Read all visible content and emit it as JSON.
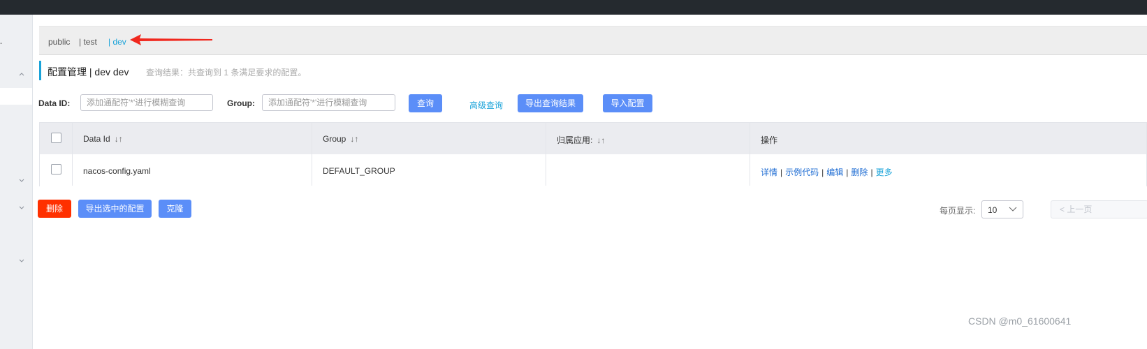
{
  "namespaces": [
    {
      "label": "public"
    },
    {
      "label": "| test"
    },
    {
      "label": "| dev"
    }
  ],
  "colors": {
    "accent": "#1aa3d9",
    "primary_button": "#5b8ef8",
    "danger_button": "#ff3000",
    "topbar": "#252a2f"
  },
  "page": {
    "title": "配置管理 | dev dev",
    "query_result": "查询结果：共查询到 1 条满足要求的配置。"
  },
  "filters": {
    "data_id_label": "Data ID:",
    "data_id_placeholder": "添加通配符'*'进行模糊查询",
    "group_label": "Group:",
    "group_placeholder": "添加通配符'*'进行模糊查询",
    "search_button": "查询",
    "advanced_query": "高级查询",
    "export_results_button": "导出查询结果",
    "import_button": "导入配置"
  },
  "table": {
    "columns": [
      "Data Id",
      "Group",
      "归属应用:",
      "操作"
    ],
    "sort_icon": "sort-icon",
    "rows": [
      {
        "data_id": "nacos-config.yaml",
        "group": "DEFAULT_GROUP",
        "app": "",
        "actions": [
          "详情",
          "示例代码",
          "编辑",
          "删除",
          "更多"
        ]
      }
    ]
  },
  "bulk": {
    "delete_button": "删除",
    "export_selected_button": "导出选中的配置",
    "clone_button": "克隆"
  },
  "pagination": {
    "page_size_label": "每页显示:",
    "page_size_value": "10",
    "prev_label": "上一页"
  },
  "watermark": "CSDN @m0_61600641"
}
